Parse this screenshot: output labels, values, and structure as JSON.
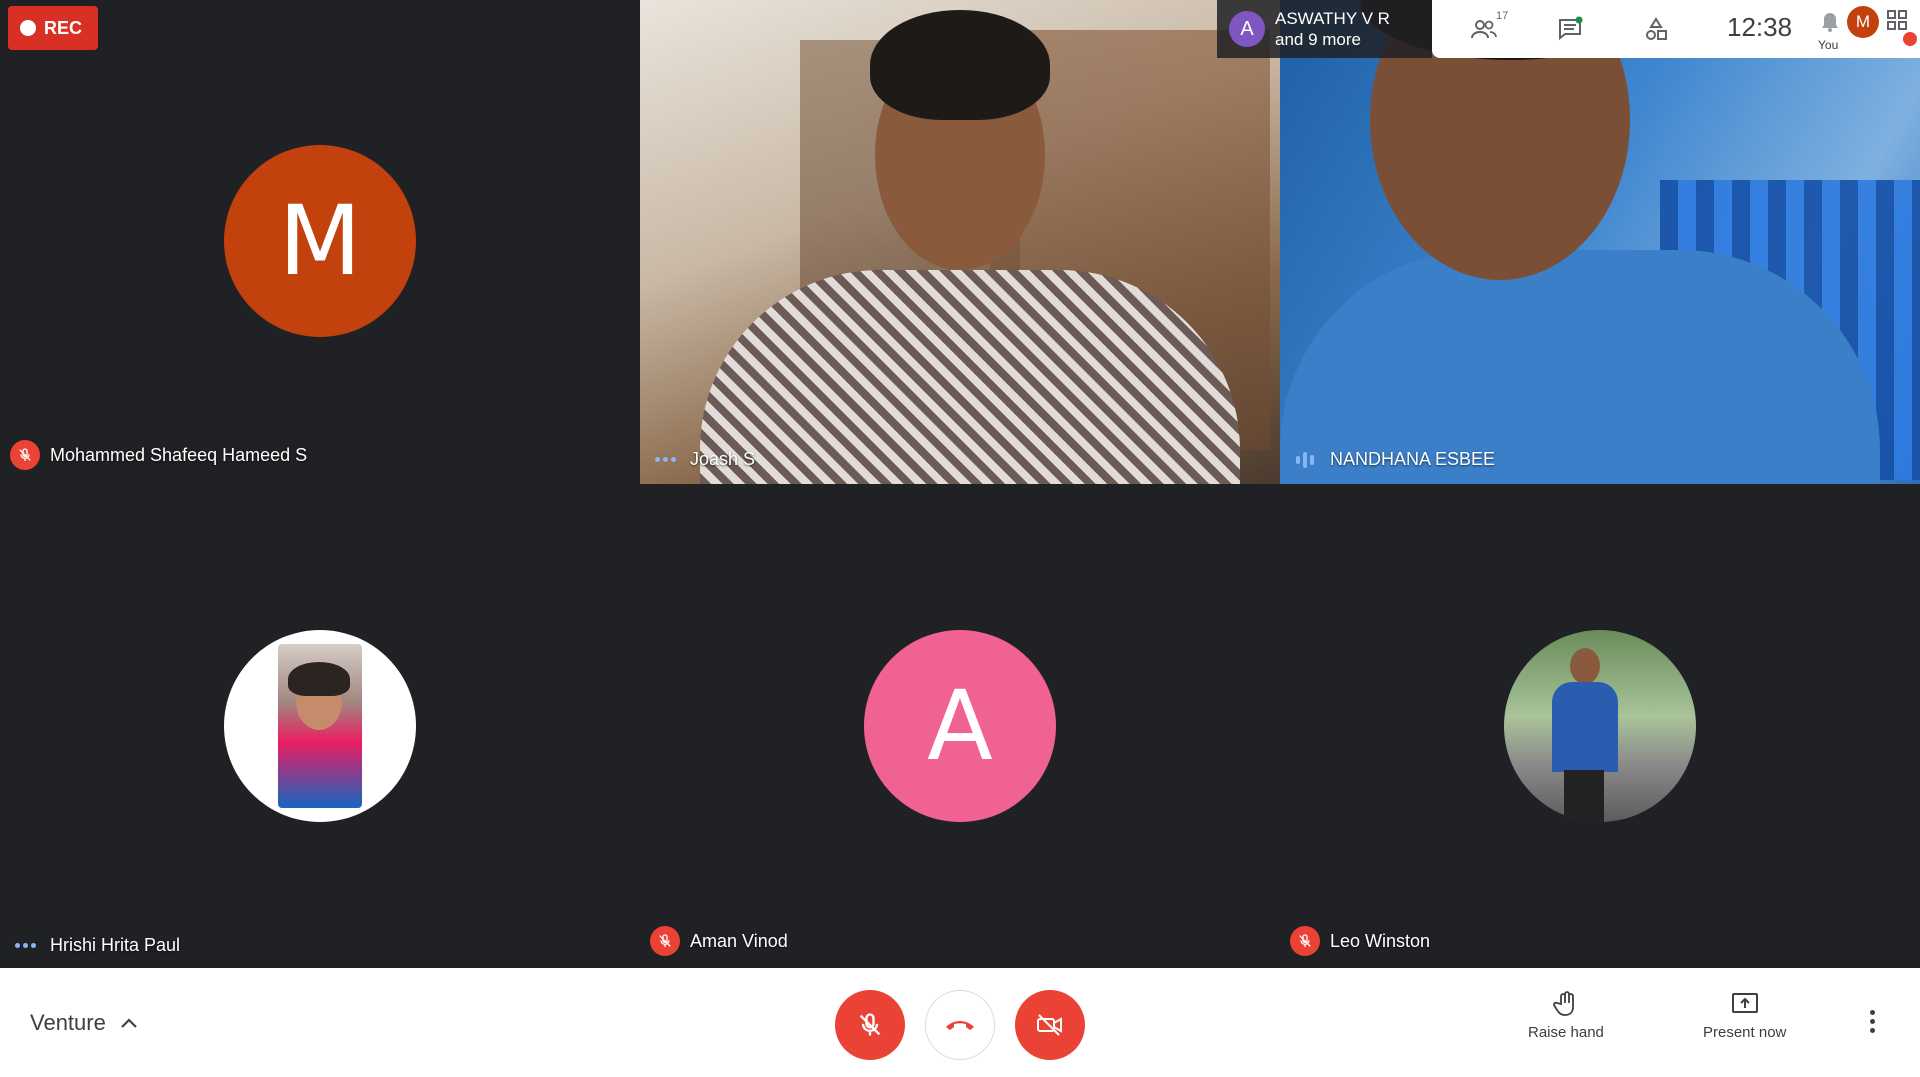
{
  "rec": {
    "label": "REC"
  },
  "active_speaker": {
    "initial": "A",
    "name": "ASWATHY V R",
    "more": "and 9 more"
  },
  "topbar": {
    "participant_count": "17",
    "time": "12:38",
    "self_initial": "M",
    "self_label": "You"
  },
  "tiles": [
    {
      "name": "Mohammed Shafeeq Hameed S",
      "type": "avatar",
      "initial": "M",
      "color": "#c2410c",
      "status": "muted"
    },
    {
      "name": "Joash S",
      "type": "video",
      "status": "dots"
    },
    {
      "name": "NANDHANA ESBEE",
      "type": "video",
      "status": "speaking"
    },
    {
      "name": "Hrishi Hrita Paul",
      "type": "photo",
      "status": "dots"
    },
    {
      "name": "Aman Vinod",
      "type": "avatar",
      "initial": "A",
      "color": "#f06292",
      "status": "muted"
    },
    {
      "name": "Leo Winston",
      "type": "photo",
      "status": "muted"
    }
  ],
  "bottombar": {
    "meeting_name": "Venture",
    "raise_hand_label": "Raise hand",
    "present_label": "Present now"
  }
}
